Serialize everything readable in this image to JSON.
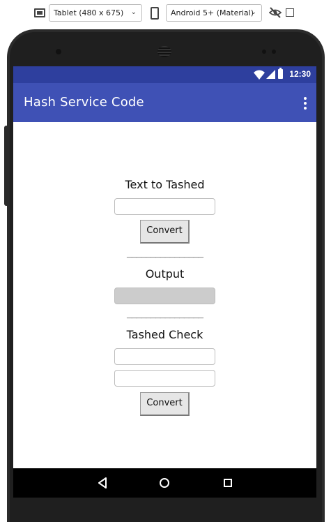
{
  "toolbar": {
    "device_select": "Tablet (480 x 675)",
    "theme_select": "Android 5+ (Material)"
  },
  "status_bar": {
    "time": "12:30"
  },
  "app_bar": {
    "title": "Hash Service Code"
  },
  "form": {
    "input_label": "Text to Tashed",
    "input_value": "",
    "convert_label": "Convert",
    "divider": "________________",
    "output_label": "Output",
    "check_label": "Tashed Check",
    "check_input_1": "",
    "check_input_2": "",
    "check_convert_label": "Convert"
  },
  "colors": {
    "status_bar": "#2e3f9e",
    "app_bar": "#3f51b5",
    "output_bg": "#cccccc"
  }
}
